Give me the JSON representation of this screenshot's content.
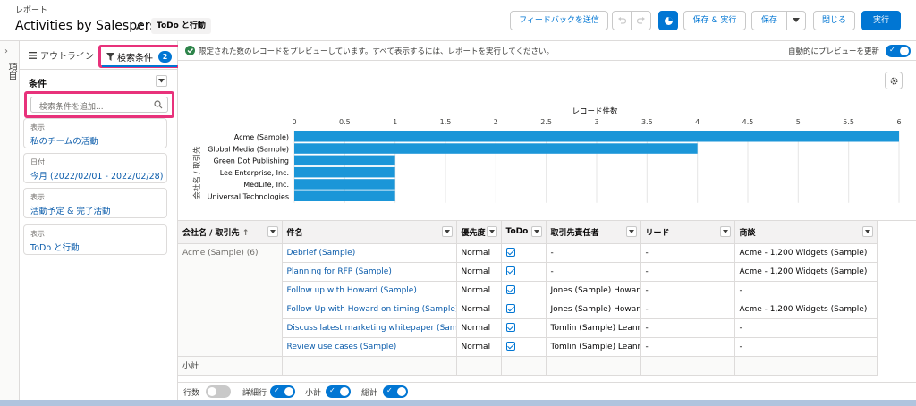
{
  "header": {
    "breadcrumb": "レポート",
    "title": "Activities by Salesperson",
    "report_type": "ToDo と行動",
    "feedback_button": "フィードバックを送信",
    "save_run_button": "保存 & 実行",
    "save_button": "保存",
    "close_button": "閉じる",
    "run_button": "実行"
  },
  "rail": {
    "label": "項目"
  },
  "panel": {
    "tab_outline": "アウトライン",
    "tab_filters": "検索条件",
    "filter_count": "2",
    "conditions_heading": "条件",
    "search_placeholder": "検索条件を追加...",
    "filters": [
      {
        "label": "表示",
        "value": "私のチームの活動"
      },
      {
        "label": "日付",
        "value": "今月 (2022/02/01 - 2022/02/28)"
      },
      {
        "label": "表示",
        "value": "活動予定 & 完了活動"
      },
      {
        "label": "表示",
        "value": "ToDo と行動"
      }
    ]
  },
  "preview": {
    "message": "限定された数のレコードをプレビューしています。すべて表示するには、レポートを実行してください。",
    "auto_label": "自動的にプレビューを更新"
  },
  "chart_data": {
    "type": "bar",
    "orientation": "horizontal",
    "title": "レコード件数",
    "ylabel": "会社名 / 取引先",
    "categories": [
      "Acme (Sample)",
      "Global Media (Sample)",
      "Green Dot Publishing",
      "Lee Enterprise, Inc.",
      "MedLife, Inc.",
      "Universal Technologies"
    ],
    "values": [
      6,
      4,
      1,
      1,
      1,
      1
    ],
    "xlim": [
      0,
      6
    ],
    "ticks": [
      "0",
      "0.5",
      "1",
      "1.5",
      "2",
      "2.5",
      "3",
      "3.5",
      "4",
      "4.5",
      "5",
      "5.5",
      "6"
    ],
    "bar_color": "#1b96d8",
    "grid": true
  },
  "table": {
    "headers": [
      "会社名 / 取引先",
      "件名",
      "優先度",
      "ToDo",
      "取引先責任者",
      "リード",
      "商談"
    ],
    "group_label": "Acme (Sample) (6)",
    "rows": [
      {
        "subject": "Debrief (Sample)",
        "priority": "Normal",
        "contact": "-",
        "lead": "-",
        "opportunity": "Acme - 1,200 Widgets (Sample)"
      },
      {
        "subject": "Planning for RFP (Sample)",
        "priority": "Normal",
        "contact": "-",
        "lead": "-",
        "opportunity": "Acme - 1,200 Widgets (Sample)"
      },
      {
        "subject": "Follow up with Howard (Sample)",
        "priority": "Normal",
        "contact": "Jones (Sample) Howard",
        "lead": "-",
        "opportunity": "-"
      },
      {
        "subject": "Follow Up with Howard on timing (Sample)",
        "priority": "Normal",
        "contact": "Jones (Sample) Howard",
        "lead": "-",
        "opportunity": "Acme - 1,200 Widgets (Sample)"
      },
      {
        "subject": "Discuss latest marketing whitepaper (Sample)",
        "priority": "Normal",
        "contact": "Tomlin (Sample) Leanne",
        "lead": "-",
        "opportunity": "-"
      },
      {
        "subject": "Review use cases (Sample)",
        "priority": "Normal",
        "contact": "Tomlin (Sample) Leanne",
        "lead": "-",
        "opportunity": "-"
      }
    ],
    "subtotal_label": "小計"
  },
  "footer": {
    "row_count": "行数",
    "detail_rows": "詳細行",
    "subtotals": "小計",
    "grand_total": "総計"
  }
}
